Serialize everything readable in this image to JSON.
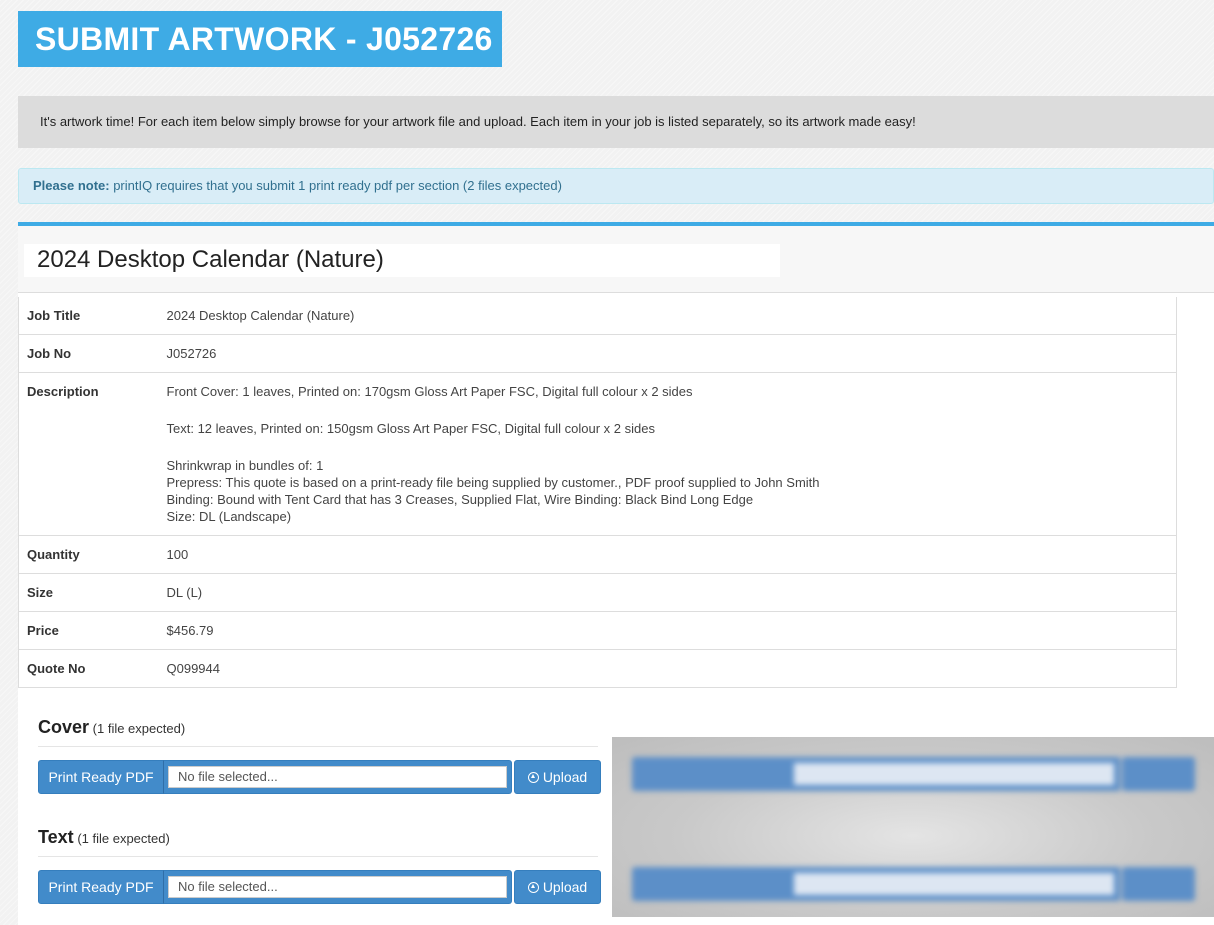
{
  "page_title": "SUBMIT ARTWORK - J052726",
  "intro_text": "It's artwork time! For each item below simply browse for your artwork file and upload. Each item in your job is listed separately, so its artwork made easy!",
  "note": {
    "label": "Please note:",
    "text": " printIQ requires that you submit 1 print ready pdf per section (2 files expected)"
  },
  "job": {
    "heading": "2024 Desktop Calendar (Nature)",
    "rows": {
      "job_title": {
        "key": "Job Title",
        "value": "2024 Desktop Calendar (Nature)"
      },
      "job_no": {
        "key": "Job No",
        "value": "J052726"
      },
      "description": {
        "key": "Description",
        "lines": [
          "Front Cover: 1 leaves, Printed on: 170gsm Gloss Art Paper FSC, Digital full colour x 2 sides",
          "Text: 12 leaves, Printed on: 150gsm Gloss Art Paper FSC, Digital full colour x 2 sides",
          "Shrinkwrap in bundles of: 1",
          "Prepress: This quote is based on a print-ready file being supplied by customer., PDF proof supplied to John Smith",
          "Binding: Bound with Tent Card that has 3 Creases, Supplied Flat, Wire Binding: Black Bind Long Edge",
          "Size: DL (Landscape)"
        ]
      },
      "quantity": {
        "key": "Quantity",
        "value": "100"
      },
      "size": {
        "key": "Size",
        "value": "DL (L)"
      },
      "price": {
        "key": "Price",
        "value": "$456.79"
      },
      "quote_no": {
        "key": "Quote No",
        "value": "Q099944"
      }
    }
  },
  "sections": {
    "cover": {
      "name": "Cover",
      "expected": "(1 file expected)",
      "file_type_label": "Print Ready PDF",
      "file_input_value": "No file selected...",
      "upload_label": "Upload"
    },
    "text": {
      "name": "Text",
      "expected": "(1 file expected)",
      "file_type_label": "Print Ready PDF",
      "file_input_value": "No file selected...",
      "upload_label": "Upload"
    }
  },
  "colors": {
    "brand_blue": "#3eabe5",
    "button_blue": "#428bca",
    "note_bg": "#d9edf7",
    "note_text": "#31708f"
  },
  "icons": {
    "upload": "circle-arrow-up-icon"
  }
}
